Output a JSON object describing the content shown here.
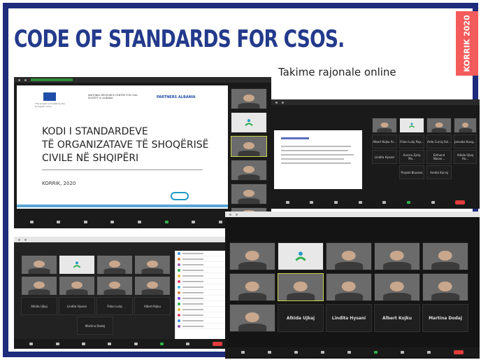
{
  "slide": {
    "title": "CODE OF STANDARDS FOR CSOS.",
    "badge": "KORRIK 2020",
    "subtitle": "Takime rajonale online",
    "colors": {
      "frame": "#1f2b7c",
      "title": "#233a8c",
      "badge": "#f45b5b"
    }
  },
  "presentation": {
    "heading_line1": "KODI I STANDARDEVE",
    "heading_line2": "TË ORGANIZATAVE TË SHOQËRISË",
    "heading_line3": "CIVILE NË SHQIPËRI",
    "date": "KORRIK, 2020",
    "partner1": "NATIONAL RESOURCE CENTRE FOR CIVIL SOCIETY in ALBANIA",
    "partner2": "PARTNERS ALBANIA",
    "eu_caption": "This project is funded by the European Union"
  },
  "meeting_right": {
    "names": [
      "Alkida Ujkaj",
      "Lindita Hysani",
      "Albert Kojku",
      "Martina Dodaj"
    ]
  },
  "meeting_bottom_left": {
    "names": [
      "Alkida Ujkaj",
      "Lindita Hysani",
      "Fidan Lulaj",
      "Albert Kojku",
      "Martina Dodaj"
    ]
  },
  "meeting_middle": {
    "names": [
      "Albert Kojku Ar...",
      "Fidan Lulaj Pap...",
      "Arda Curraj Sal...",
      "Jansaka Kung...",
      "Lindita Hysani",
      "Aurora Zytaj Ma...",
      "Edmond Nasan...",
      "Alkida Ujkaj Hu...",
      "Projekt Bluesea",
      "Aredia Kurraj"
    ]
  }
}
